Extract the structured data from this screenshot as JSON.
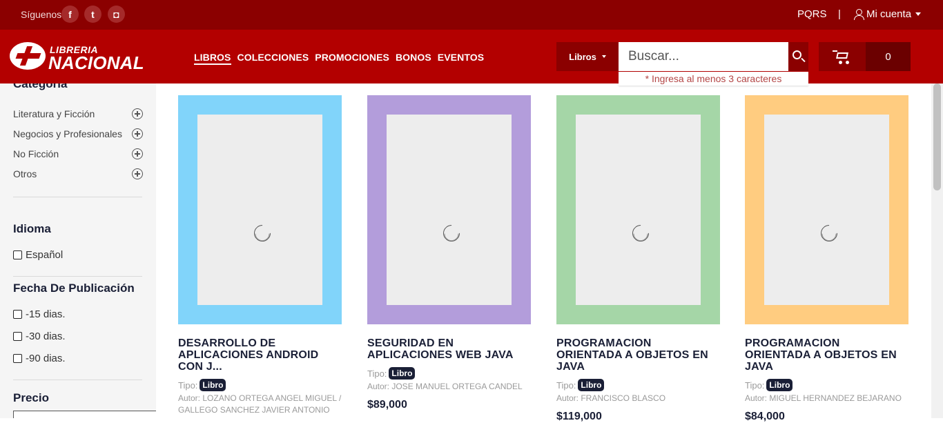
{
  "topbar": {
    "follow_label": "Síguenos",
    "social": [
      {
        "name": "facebook-icon",
        "glyph": "f"
      },
      {
        "name": "twitter-icon",
        "glyph": "t"
      },
      {
        "name": "instagram-icon",
        "glyph": "◘"
      }
    ],
    "pqrs": "PQRS",
    "separator": "|",
    "account": "Mi cuenta"
  },
  "header": {
    "logo_top": "LIBRERIA",
    "logo_bottom": "NACIONAL",
    "nav": [
      "LIBROS",
      "COLECCIONES",
      "PROMOCIONES",
      "BONOS",
      "EVENTOS"
    ],
    "search_category": "Libros",
    "search_placeholder": "Buscar...",
    "search_hint": "* Ingresa al menos 3 caracteres",
    "cart_count": "0"
  },
  "sidebar": {
    "category_heading": "Categoría",
    "categories": [
      "Literatura y Ficción",
      "Negocios y Profesionales",
      "No Ficción",
      "Otros"
    ],
    "language_heading": "Idioma",
    "languages": [
      "Español"
    ],
    "date_heading": "Fecha De Publicación",
    "dates": [
      "-15 dias.",
      "-30 dias.",
      "-90 dias."
    ],
    "price_heading": "Precio"
  },
  "products": [
    {
      "title": "DESARROLLO DE APLICACIONES ANDROID CON J...",
      "type_label": "Tipo:",
      "type": "Libro",
      "author": "Autor: LOZANO ORTEGA ANGEL MIGUEL / GALLEGO SANCHEZ JAVIER ANTONIO",
      "price": "",
      "cover_color": "#81d4fa"
    },
    {
      "title": "SEGURIDAD EN APLICACIONES WEB JAVA",
      "type_label": "Tipo:",
      "type": "Libro",
      "author": "Autor: JOSE MANUEL ORTEGA CANDEL",
      "price": "$89,000",
      "cover_color": "#b39ddb"
    },
    {
      "title": "PROGRAMACION ORIENTADA A OBJETOS EN JAVA",
      "type_label": "Tipo:",
      "type": "Libro",
      "author": "Autor: FRANCISCO BLASCO",
      "price": "$119,000",
      "cover_color": "#a5d6a7"
    },
    {
      "title": "PROGRAMACION ORIENTADA A OBJETOS EN JAVA",
      "type_label": "Tipo:",
      "type": "Libro",
      "author": "Autor: MIGUEL HERNANDEZ BEJARANO",
      "price": "$84,000",
      "cover_color": "#ffcc80"
    }
  ],
  "colors": {
    "topbar": "#8b0000",
    "header": "#b30000",
    "dark_text": "#1a1f36"
  }
}
